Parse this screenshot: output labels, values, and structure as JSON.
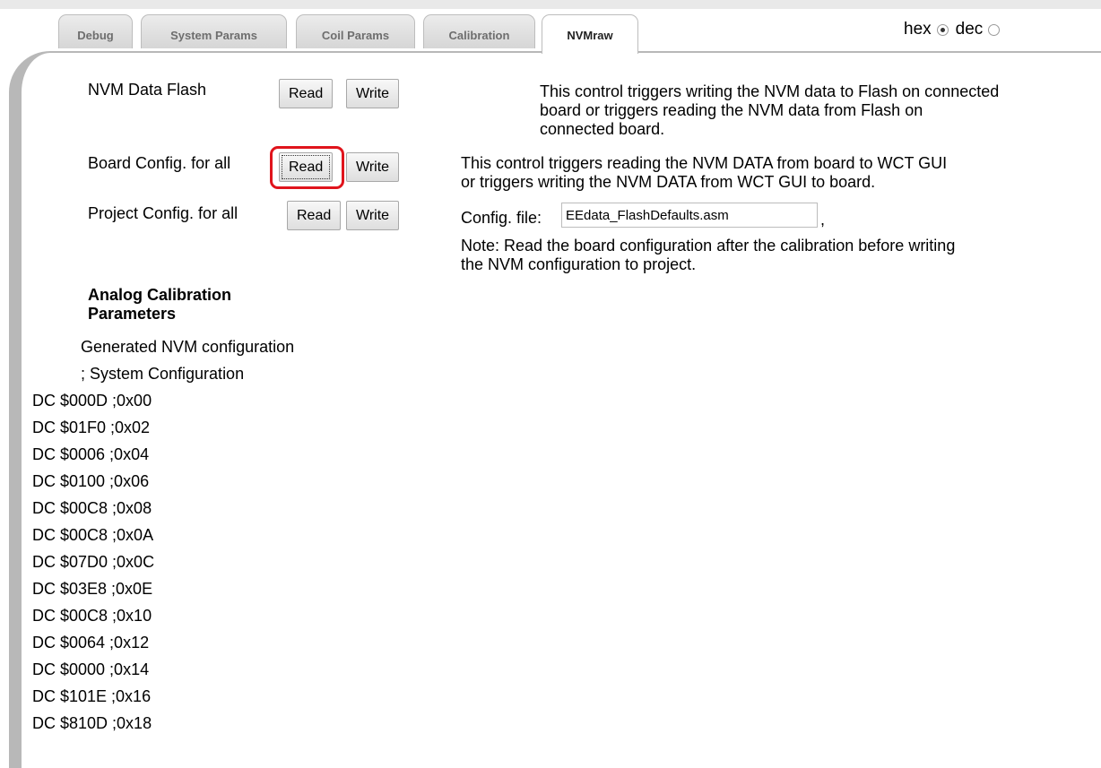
{
  "tabs": [
    {
      "label": "Debug"
    },
    {
      "label": "System Params"
    },
    {
      "label": "Coil Params"
    },
    {
      "label": "Calibration"
    },
    {
      "label": "NVMraw"
    }
  ],
  "active_tab": "NVMraw",
  "units": {
    "hex_label": "hex",
    "dec_label": "dec",
    "selected": "hex"
  },
  "nvm_flash": {
    "label": "NVM Data Flash",
    "read": "Read",
    "write": "Write",
    "desc_line1": "This control triggers writing the NVM data to Flash on connected",
    "desc_line2": "board or triggers reading the NVM data from Flash on",
    "desc_line3": "connected board."
  },
  "board_config": {
    "label": "Board Config. for all",
    "read": "Read",
    "write": "Write",
    "desc_line1": "This control triggers reading the NVM DATA from board to WCT GUI",
    "desc_line2": "or triggers writing the NVM DATA from WCT GUI to board."
  },
  "project_config": {
    "label": "Project Config. for all",
    "read": "Read",
    "write": "Write",
    "config_file_label": "Config. file:",
    "config_file_value": "EEdata_FlashDefaults.asm",
    "comma": ",",
    "note_line1": "Note: Read the board configuration after the calibration before writing",
    "note_line2": "the NVM configuration to project."
  },
  "analog": {
    "title_line1": "Analog Calibration",
    "title_line2": "Parameters",
    "generated": "Generated NVM configuration",
    "system_config": "; System Configuration",
    "lines": [
      "DC $000D ;0x00",
      "DC $01F0 ;0x02",
      "DC $0006 ;0x04",
      "DC $0100 ;0x06",
      "DC $00C8 ;0x08",
      "DC $00C8 ;0x0A",
      "DC $07D0 ;0x0C",
      "DC $03E8 ;0x0E",
      "DC $00C8 ;0x10",
      "DC $0064 ;0x12",
      "DC $0000 ;0x14",
      "DC $101E ;0x16",
      "DC $810D ;0x18"
    ]
  }
}
